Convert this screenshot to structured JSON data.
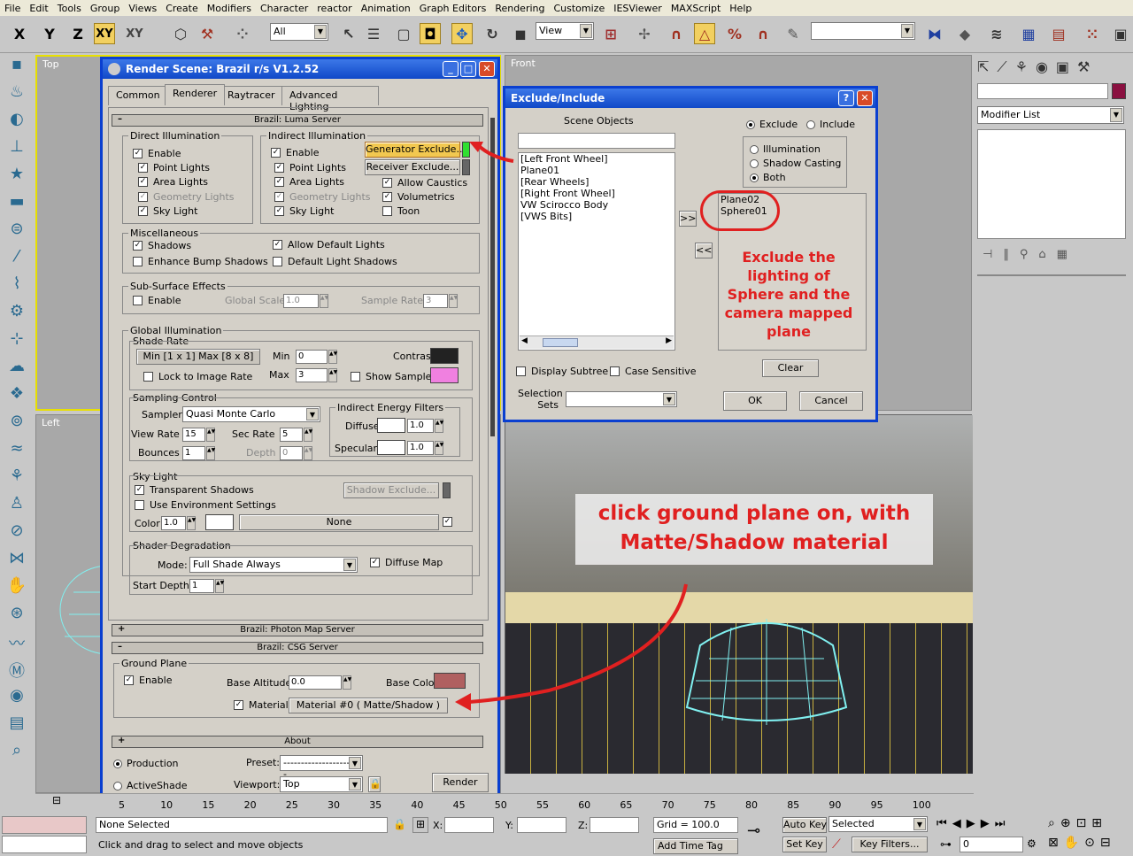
{
  "menu": [
    "File",
    "Edit",
    "Tools",
    "Group",
    "Views",
    "Create",
    "Modifiers",
    "Character",
    "reactor",
    "Animation",
    "Graph Editors",
    "Rendering",
    "Customize",
    "IESViewer",
    "MAXScript",
    "Help"
  ],
  "toolbar": {
    "axis_x": "X",
    "axis_y": "Y",
    "axis_z": "Z",
    "axis_xy": "XY",
    "axis_xy2": "XY",
    "filter_value": "All",
    "refcoord_value": "View"
  },
  "viewports": {
    "top": "Top",
    "front": "Front",
    "left": "Left"
  },
  "render_scene": {
    "title": "Render Scene: Brazil r/s V1.2.52",
    "tabs": [
      "Common",
      "Renderer",
      "Raytracer",
      "Advanced Lighting"
    ],
    "luma_header": "Brazil: Luma Server",
    "direct": {
      "label": "Direct Illumination",
      "items": [
        "Enable",
        "Point Lights",
        "Area Lights",
        "Geometry Lights",
        "Sky Light"
      ]
    },
    "indirect": {
      "label": "Indirect Illumination",
      "items": [
        "Enable",
        "Point Lights",
        "Area Lights",
        "Geometry Lights",
        "Sky Light"
      ],
      "gen_exclude": "Generator Exclude...",
      "rec_exclude": "Receiver Exclude...",
      "caustics": "Allow Caustics",
      "volumetrics": "Volumetrics",
      "toon": "Toon"
    },
    "misc": {
      "label": "Miscellaneous",
      "shadows": "Shadows",
      "bump": "Enhance Bump Shadows",
      "allow_default": "Allow Default Lights",
      "default_shadows": "Default Light Shadows"
    },
    "sss": {
      "label": "Sub-Surface Effects",
      "enable": "Enable",
      "global_scale": "Global Scale",
      "global_scale_val": "1.0",
      "sample_rate": "Sample Rate",
      "sample_rate_val": "3"
    },
    "gi": {
      "label": "Global Illumination",
      "shade_rate": "Shade Rate",
      "minmax": "Min [1 x 1]  Max [8 x 8]",
      "min": "Min",
      "min_val": "0",
      "max": "Max",
      "max_val": "3",
      "contrast": "Contrast",
      "lock": "Lock to Image Rate",
      "show_samples": "Show Samples",
      "sampling": "Sampling Control",
      "sampler": "Sampler:",
      "sampler_val": "Quasi Monte Carlo",
      "view_rate": "View Rate",
      "view_rate_val": "15",
      "sec_rate": "Sec Rate",
      "sec_rate_val": "5",
      "bounces": "Bounces",
      "bounces_val": "1",
      "depth": "Depth",
      "depth_val": "0",
      "energy": "Indirect Energy Filters",
      "diffuse": "Diffuse",
      "diffuse_val": "1.0",
      "specular": "Specular",
      "specular_val": "1.0"
    },
    "sky": {
      "label": "Sky Light",
      "transparent": "Transparent Shadows",
      "use_env": "Use Environment Settings",
      "shadow_exclude": "Shadow Exclude...",
      "color": "Color",
      "color_val": "1.0",
      "none": "None"
    },
    "shader": {
      "label": "Shader Degradation",
      "mode": "Mode:",
      "mode_val": "Full Shade Always",
      "diffuse_map": "Diffuse Map",
      "start_depth": "Start Depth:",
      "start_depth_val": "1"
    },
    "photon_header": "Brazil: Photon Map Server",
    "csg_header": "Brazil: CSG Server",
    "ground": {
      "label": "Ground Plane",
      "enable": "Enable",
      "base_alt": "Base Altitude",
      "base_alt_val": "0.0",
      "base_color": "Base Color",
      "material": "Material",
      "material_val": "Material #0  ( Matte/Shadow )"
    },
    "about_header": "About",
    "production": "Production",
    "activeshade": "ActiveShade",
    "preset": "Preset:",
    "preset_val": "----------------------",
    "viewport": "Viewport:",
    "viewport_val": "Top",
    "render": "Render"
  },
  "exclude": {
    "title": "Exclude/Include",
    "scene_objects": "Scene Objects",
    "objects": [
      "[Left Front Wheel]",
      "Plane01",
      "[Rear Wheels]",
      "[Right Front Wheel]",
      "VW Scirocco Body",
      "[VWS Bits]"
    ],
    "exclude_label": "Exclude",
    "include_label": "Include",
    "illumination": "Illumination",
    "shadow_casting": "Shadow Casting",
    "both": "Both",
    "excluded": [
      "Plane02",
      "Sphere01"
    ],
    "add": ">>",
    "remove": "<<",
    "display_subtree": "Display Subtree",
    "case_sensitive": "Case Sensitive",
    "selection_sets": "Selection Sets",
    "clear": "Clear",
    "ok": "OK",
    "cancel": "Cancel"
  },
  "annotations": {
    "note1": "Exclude the lighting of Sphere and the camera mapped plane",
    "note2": "click ground plane on, with Matte/Shadow material"
  },
  "command_panel": {
    "modifier_list": "Modifier List"
  },
  "timeline": {
    "ticks": [
      "5",
      "10",
      "15",
      "20",
      "25",
      "30",
      "35",
      "40",
      "45",
      "50",
      "55",
      "60",
      "65",
      "70",
      "75",
      "80",
      "85",
      "90",
      "95",
      "100"
    ]
  },
  "status": {
    "none_selected": "None Selected",
    "prompt": "Click and drag to select and move objects",
    "x": "X:",
    "y": "Y:",
    "z": "Z:",
    "grid": "Grid = 100.0",
    "add_time_tag": "Add Time Tag",
    "auto_key": "Auto Key",
    "set_key": "Set Key",
    "selected": "Selected",
    "key_filters": "Key Filters...",
    "frame": "0",
    "track_val": "0"
  },
  "colors": {
    "accent": "#0a3fd0",
    "annotation": "#e02020",
    "generator_button": "#f2c850"
  }
}
